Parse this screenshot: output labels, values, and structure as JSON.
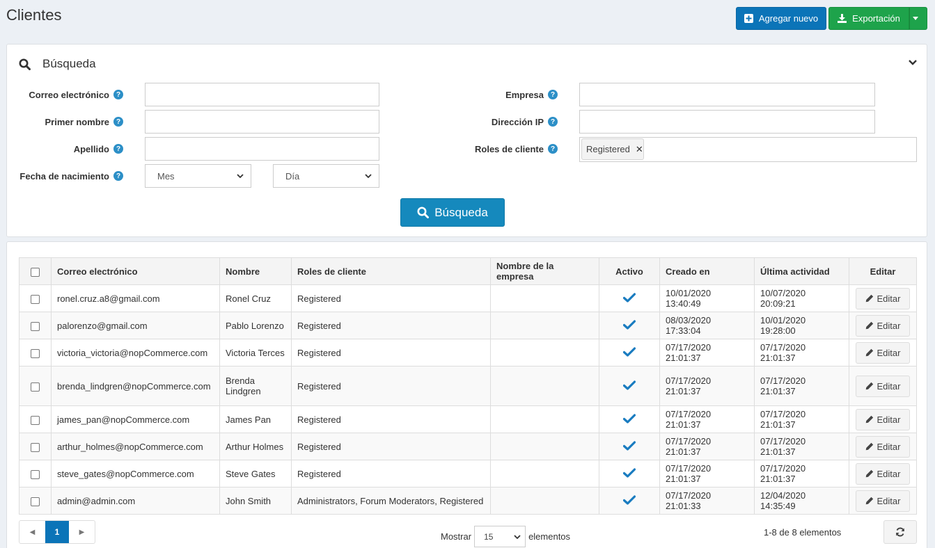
{
  "page": {
    "title": "Clientes"
  },
  "header_buttons": {
    "add_new": "Agregar nuevo",
    "export": "Exportación"
  },
  "search": {
    "title": "Búsqueda",
    "fields": {
      "email_label": "Correo electrónico",
      "first_name_label": "Primer nombre",
      "last_name_label": "Apellido",
      "dob_label": "Fecha de nacimiento",
      "company_label": "Empresa",
      "ip_label": "Dirección IP",
      "roles_label": "Roles de cliente",
      "month_value": "Mes",
      "day_value": "Día",
      "selected_role": "Registered"
    },
    "button": "Búsqueda"
  },
  "grid": {
    "columns": [
      "Correo electrónico",
      "Nombre",
      "Roles de cliente",
      "Nombre de la empresa",
      "Activo",
      "Creado en",
      "Última actividad",
      "Editar"
    ],
    "edit_label": "Editar",
    "rows": [
      {
        "email": "ronel.cruz.a8@gmail.com",
        "name": "Ronel Cruz",
        "roles": "Registered",
        "company": "",
        "active": true,
        "created": "10/01/2020 13:40:49",
        "last": "10/07/2020 20:09:21"
      },
      {
        "email": "palorenzo@gmail.com",
        "name": "Pablo Lorenzo",
        "roles": "Registered",
        "company": "",
        "active": true,
        "created": "08/03/2020 17:33:04",
        "last": "10/01/2020 19:28:00"
      },
      {
        "email": "victoria_victoria@nopCommerce.com",
        "name": "Victoria Terces",
        "roles": "Registered",
        "company": "",
        "active": true,
        "created": "07/17/2020 21:01:37",
        "last": "07/17/2020 21:01:37"
      },
      {
        "email": "brenda_lindgren@nopCommerce.com",
        "name": "Brenda Lindgren",
        "roles": "Registered",
        "company": "",
        "active": true,
        "created": "07/17/2020 21:01:37",
        "last": "07/17/2020 21:01:37"
      },
      {
        "email": "james_pan@nopCommerce.com",
        "name": "James Pan",
        "roles": "Registered",
        "company": "",
        "active": true,
        "created": "07/17/2020 21:01:37",
        "last": "07/17/2020 21:01:37"
      },
      {
        "email": "arthur_holmes@nopCommerce.com",
        "name": "Arthur Holmes",
        "roles": "Registered",
        "company": "",
        "active": true,
        "created": "07/17/2020 21:01:37",
        "last": "07/17/2020 21:01:37"
      },
      {
        "email": "steve_gates@nopCommerce.com",
        "name": "Steve Gates",
        "roles": "Registered",
        "company": "",
        "active": true,
        "created": "07/17/2020 21:01:37",
        "last": "07/17/2020 21:01:37"
      },
      {
        "email": "admin@admin.com",
        "name": "John Smith",
        "roles": "Administrators, Forum Moderators, Registered",
        "company": "",
        "active": true,
        "created": "07/17/2020 21:01:33",
        "last": "12/04/2020 14:35:49"
      }
    ]
  },
  "pagination": {
    "current_page": "1",
    "show_label": "Mostrar",
    "page_size": "15",
    "items_label": "elementos",
    "info": "1-8 de 8 elementos"
  },
  "colors": {
    "primary": "#0b74b8",
    "success": "#1ea34b",
    "info": "#1589bd",
    "check": "#1a7cc0"
  }
}
